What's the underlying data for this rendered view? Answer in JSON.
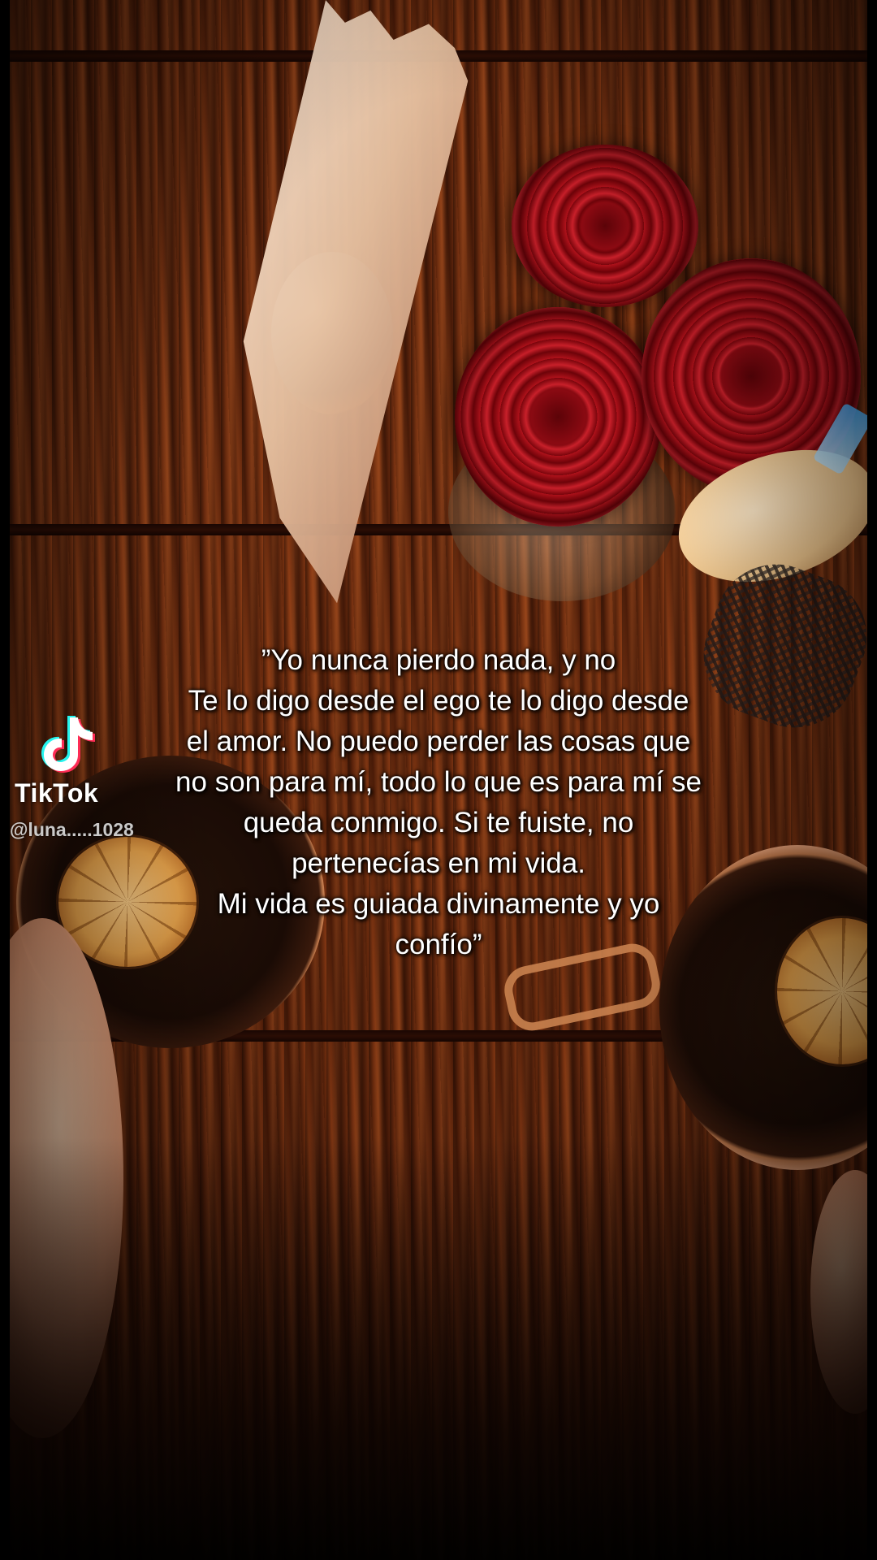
{
  "quote": {
    "lines": [
      "”Yo nunca pierdo nada, y no",
      "Te lo digo desde el ego te lo digo desde",
      "el amor. No puedo perder las cosas que",
      "no son para mí, todo lo que es para mí se",
      "queda conmigo. Si te fuiste, no",
      "pertenecías en mi vida.",
      "Mi vida es guiada divinamente y yo",
      "confío”"
    ]
  },
  "watermark": {
    "brand": "TikTok",
    "handle": "@luna.....1028",
    "icon": "tiktok-logo-icon"
  },
  "colors": {
    "text": "#ffffff",
    "rose": "#a50f18",
    "wood": "#6b2a0d",
    "tiktok_cyan": "#25f4ee",
    "tiktok_red": "#fe2c55"
  }
}
